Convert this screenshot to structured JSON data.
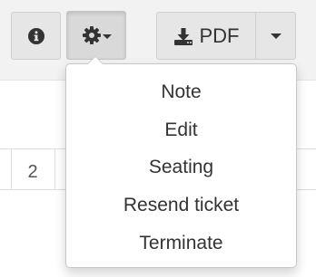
{
  "toolbar": {
    "info_icon": "info-circle-icon",
    "gear_icon": "gear-icon",
    "pdf_icon": "download-icon",
    "pdf_label": "PDF",
    "caret_icon": "caret-down-icon"
  },
  "table": {
    "visible_cell": "2"
  },
  "menu": {
    "items": [
      "Note",
      "Edit",
      "Seating",
      "Resend ticket",
      "Terminate"
    ]
  },
  "colors": {
    "button_bg": "#e6e6e6",
    "active_button_bg": "#d9d9d9",
    "text": "#333333"
  }
}
